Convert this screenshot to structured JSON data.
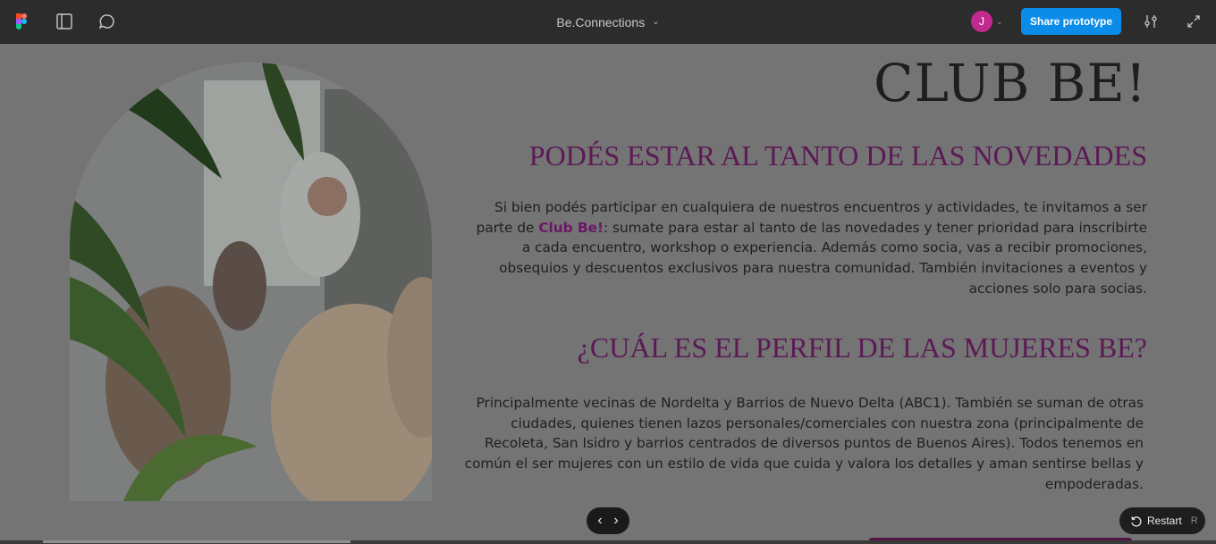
{
  "toolbar": {
    "file_title": "Be.Connections",
    "user_initial": "J",
    "share_label": "Share prototype",
    "icons": [
      "figma-logo-icon",
      "sidebar-toggle-icon",
      "comment-icon",
      "chevron-down-icon",
      "settings-sliders-icon",
      "expand-icon"
    ]
  },
  "prototype": {
    "heading": "CLUB BE!",
    "news_heading": "PODÉS ESTAR AL TANTO DE LAS NOVEDADES",
    "news_text_before": "Si bien podés participar en cualquiera de nuestros encuentros y actividades, te invitamos a ser parte de ",
    "news_text_strong": "Club Be!",
    "news_text_after": ": sumate para estar al tanto de las novedades y tener prioridad para inscribirte a cada encuentro, workshop o experiencia. Además como socia, vas a recibir promociones, obsequios y descuentos exclusivos para nuestra comunidad. También invitaciones a eventos y acciones solo para socias.",
    "profile_heading": "¿CUÁL ES EL PERFIL DE LAS MUJERES BE?",
    "profile_text": "Principalmente vecinas de Nordelta y Barrios de Nuevo Delta (ABC1). También se suman de otras ciudades, quienes tienen lazos personales/comerciales con nuestra zona (principalmente de Recoleta, San Isidro y barrios centrados de diversos puntos de Buenos Aires). Todos tenemos en común el ser mujeres con un estilo de vida que cuida y valora los detalles y aman sentirse bellas y empoderadas."
  },
  "controls": {
    "prev_symbol": "‹",
    "next_symbol": "›",
    "restart_label": "Restart",
    "restart_shortcut": "R"
  },
  "colors": {
    "accent_purple": "#5b1a55",
    "share_blue": "#0c8ce9",
    "avatar_pink": "#c2298f"
  }
}
